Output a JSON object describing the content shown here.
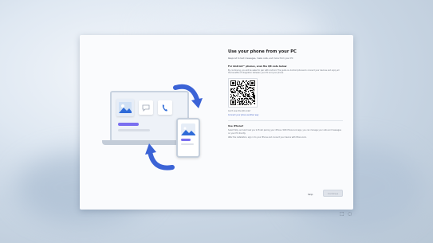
{
  "dialog": {
    "title": "Use your phone from your PC",
    "subtitle": "Respond to text messages, make calls, and more from your PC",
    "android_heading": "For Android™ phones, scan the QR code below",
    "android_text": "By continuing, you will be asked to pair with Android. The guide on Android phones to connect your devices and enjoy all the benefits of integration between your PC and your phone.",
    "cant_scan": "Can't scan the QR code?",
    "android_link": "Connect your phone another way",
    "iphone_heading": "Use iPhone?",
    "iphone_text": "Select Skip, and we'll ask you to finish pairing your iPhone. With Phone Link app, you can manage your calls and messages on your PC directly.",
    "iphone_text2": "After the installation, sign in to your iPhone and connect your device with Phone Link.",
    "skip_label": "Skip",
    "continue_label": "Continue"
  },
  "tray": {
    "icon1": "⬚",
    "icon2": "◌"
  },
  "colors": {
    "accent": "#7a6ff0",
    "arrow_blue": "#3b63d6"
  }
}
